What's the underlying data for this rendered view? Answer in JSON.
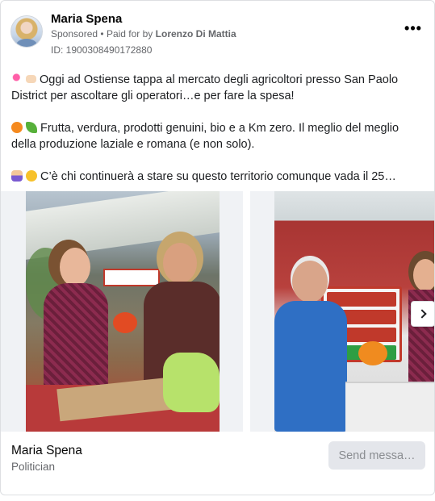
{
  "post": {
    "author": "Maria Spena",
    "sponsored_label": "Sponsored",
    "paid_for_prefix": "Paid for by",
    "paid_for_name": "Lorenzo Di Mattia",
    "id_label": "ID: 1900308490172880",
    "more_label": "•••",
    "paragraphs": [
      "Oggi ad Ostiense tappa al mercato degli agricoltori presso San Paolo District per ascoltare gli operatori…e per fare la spesa!",
      "Frutta, verdura, prodotti genuini, bio e a Km zero. Il meglio del meglio della produzione laziale e romana (e non solo).",
      "C’è chi continuerà a stare su questo territorio comunque vada il 25…"
    ],
    "icons": {
      "avatar": "avatar-image",
      "more": "more-options-icon",
      "next": "chevron-right-icon",
      "emoji_1a": "pushpin-emoji",
      "emoji_1b": "pointing-hand-emoji",
      "emoji_2a": "tangerine-emoji",
      "emoji_2b": "leafy-green-emoji",
      "emoji_3a": "person-raising-hand-emoji",
      "emoji_3b": "smiling-face-emoji"
    }
  },
  "carousel": {
    "slides": [
      {
        "alt": "Two women at a farmers market stall with vegetables"
      },
      {
        "alt": "Man holding a cut pumpkin in front of a market sign"
      }
    ],
    "sign_text": [
      "Stagionalità",
      "Opzione Km 0",
      "Filiera corta"
    ]
  },
  "footer": {
    "name": "Maria Spena",
    "subtitle": "Politician",
    "send_label": "Send messa…"
  },
  "colors": {
    "secondary_text": "#65676b",
    "button_bg": "#e4e6eb",
    "border": "#dddfe2"
  }
}
